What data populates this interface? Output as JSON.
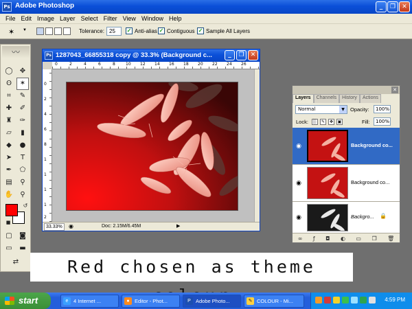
{
  "app": {
    "title": "Adobe Photoshop",
    "window_buttons": [
      "_",
      "❐",
      "✕"
    ]
  },
  "menu": [
    "File",
    "Edit",
    "Image",
    "Layer",
    "Select",
    "Filter",
    "View",
    "Window",
    "Help"
  ],
  "options": {
    "tool_icon": "magic-wand-icon",
    "tolerance_label": "Tolerance:",
    "tolerance_value": "25",
    "anti_alias_label": "Anti-alias",
    "anti_alias_checked": true,
    "contiguous_label": "Contiguous",
    "contiguous_checked": true,
    "sample_all_label": "Sample All Layers",
    "sample_all_checked": true
  },
  "toolbox": {
    "foreground_color": "#ff0000",
    "background_color": "#ffffff"
  },
  "document": {
    "title": "1287043_66855318 copy @ 33.3% (Background c...",
    "zoom": "33.33%",
    "doc_info": "Doc: 2.15M/6.45M",
    "ruler_top": [
      "0",
      "2",
      "4",
      "6",
      "8",
      "10",
      "12",
      "14",
      "16",
      "18",
      "20",
      "22",
      "24",
      "26"
    ],
    "ruler_left": [
      "0",
      "2",
      "4",
      "6",
      "8",
      "1",
      "1",
      "1",
      "1",
      "2"
    ]
  },
  "layers_panel": {
    "tabs": [
      "Layers",
      "Channels",
      "History",
      "Actions"
    ],
    "blend_mode": "Normal",
    "opacity_label": "Opacity:",
    "opacity_value": "100%",
    "lock_label": "Lock:",
    "fill_label": "Fill:",
    "fill_value": "100%",
    "layers": [
      {
        "name": "Background co...",
        "selected": true,
        "style": "red"
      },
      {
        "name": "Background co...",
        "selected": false,
        "style": "red"
      },
      {
        "name": "Backgro...",
        "selected": false,
        "style": "bw",
        "locked": true
      }
    ]
  },
  "caption": "Red chosen as theme colour",
  "taskbar": {
    "start_label": "start",
    "tasks": [
      {
        "label": "4 Internet ...",
        "icon": "ie-icon"
      },
      {
        "label": "Editor - Phot...",
        "icon": "firefox-icon"
      },
      {
        "label": "Adobe Photo...",
        "icon": "photoshop-icon",
        "active": true
      },
      {
        "label": "COLOUR - Mi...",
        "icon": "paint-icon"
      }
    ],
    "clock": "4:59 PM"
  }
}
